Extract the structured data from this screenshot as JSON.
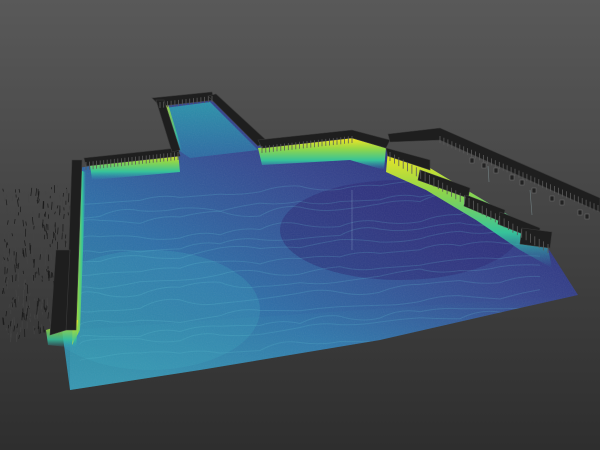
{
  "viewport": {
    "background_top": "#595959",
    "background_bottom": "#2e2e2e"
  },
  "point_cloud": {
    "colormap": [
      "#2a1c68",
      "#2f4f9a",
      "#2d7bb8",
      "#2aa5b8",
      "#36c39a",
      "#8fd64a",
      "#f5e622"
    ],
    "seabed_shallow_color": "#2f86a6",
    "seabed_deep_color": "#3a3a8c",
    "quay_wall_color": "#1e1e1e"
  }
}
